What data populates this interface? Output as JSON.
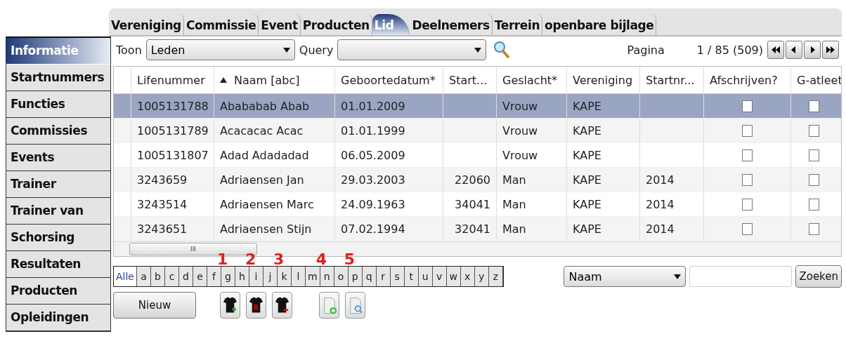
{
  "tabs": [
    {
      "label": "Vereniging",
      "selected": false
    },
    {
      "label": "Commissie",
      "selected": false
    },
    {
      "label": "Event",
      "selected": false
    },
    {
      "label": "Producten",
      "selected": false
    },
    {
      "label": "Lid",
      "selected": true
    },
    {
      "label": "Deelnemers",
      "selected": false
    },
    {
      "label": "Terrein",
      "selected": false
    },
    {
      "label": "openbare bijlage",
      "selected": false
    }
  ],
  "sidebar": {
    "items": [
      {
        "label": "Informatie",
        "selected": true
      },
      {
        "label": "Startnummers",
        "selected": false
      },
      {
        "label": "Functies",
        "selected": false
      },
      {
        "label": "Commissies",
        "selected": false
      },
      {
        "label": "Events",
        "selected": false
      },
      {
        "label": "Trainer",
        "selected": false
      },
      {
        "label": "Trainer van",
        "selected": false
      },
      {
        "label": "Schorsing",
        "selected": false
      },
      {
        "label": "Resultaten",
        "selected": false
      },
      {
        "label": "Producten",
        "selected": false
      },
      {
        "label": "Opleidingen",
        "selected": false
      }
    ]
  },
  "filter": {
    "toon_label": "Toon",
    "toon_value": "Leden",
    "query_label": "Query"
  },
  "pager": {
    "label": "Pagina",
    "position": "1 / 85 (509)"
  },
  "table": {
    "columns": [
      {
        "label": "Lifenummer",
        "sorted": false,
        "kind": "text"
      },
      {
        "label": "Naam [abc]",
        "sorted": true,
        "kind": "text"
      },
      {
        "label": "Geboortedatum*",
        "sorted": false,
        "kind": "text"
      },
      {
        "label": "Start...",
        "sorted": false,
        "kind": "number"
      },
      {
        "label": "Geslacht*",
        "sorted": false,
        "kind": "text"
      },
      {
        "label": "Vereniging",
        "sorted": false,
        "kind": "text"
      },
      {
        "label": "Startnr...",
        "sorted": false,
        "kind": "text"
      },
      {
        "label": "Afschrijven?",
        "sorted": false,
        "kind": "check"
      },
      {
        "label": "G-atleet",
        "sorted": false,
        "kind": "check"
      }
    ],
    "rows": [
      {
        "selected": true,
        "cells": [
          "1005131788",
          "Abababab Abab",
          "01.01.2009",
          "",
          "Vrouw",
          "KAPE",
          "",
          false,
          false
        ]
      },
      {
        "selected": false,
        "cells": [
          "1005131789",
          "Acacacac Acac",
          "01.01.1999",
          "",
          "Vrouw",
          "KAPE",
          "",
          false,
          false
        ]
      },
      {
        "selected": false,
        "cells": [
          "1005131807",
          "Adad Adadadad",
          "06.05.2009",
          "",
          "Vrouw",
          "KAPE",
          "",
          false,
          false
        ]
      },
      {
        "selected": false,
        "cells": [
          "3243659",
          "Adriaensen Jan",
          "29.03.2003",
          "22060",
          "Man",
          "KAPE",
          "2014",
          false,
          false
        ]
      },
      {
        "selected": false,
        "cells": [
          "3243514",
          "Adriaensen Marc",
          "24.09.1963",
          "34041",
          "Man",
          "KAPE",
          "2014",
          false,
          false
        ]
      },
      {
        "selected": false,
        "cells": [
          "3243651",
          "Adriaensen Stijn",
          "07.02.1994",
          "32041",
          "Man",
          "KAPE",
          "2014",
          false,
          false
        ]
      }
    ],
    "scroll_grip": "III"
  },
  "alphabet": [
    {
      "label": "Alle",
      "selected": true
    },
    {
      "label": "a",
      "selected": false
    },
    {
      "label": "b",
      "selected": false
    },
    {
      "label": "c",
      "selected": false
    },
    {
      "label": "d",
      "selected": false
    },
    {
      "label": "e",
      "selected": false
    },
    {
      "label": "f",
      "selected": false
    },
    {
      "label": "g",
      "selected": false,
      "mark": "1"
    },
    {
      "label": "h",
      "selected": false
    },
    {
      "label": "i",
      "selected": false,
      "mark": "2"
    },
    {
      "label": "j",
      "selected": false
    },
    {
      "label": "k",
      "selected": false,
      "mark": "3"
    },
    {
      "label": "l",
      "selected": false
    },
    {
      "label": "m",
      "selected": false
    },
    {
      "label": "n",
      "selected": false,
      "mark": "4"
    },
    {
      "label": "o",
      "selected": false
    },
    {
      "label": "p",
      "selected": false,
      "mark": "5"
    },
    {
      "label": "q",
      "selected": false
    },
    {
      "label": "r",
      "selected": false
    },
    {
      "label": "s",
      "selected": false
    },
    {
      "label": "t",
      "selected": false
    },
    {
      "label": "u",
      "selected": false
    },
    {
      "label": "v",
      "selected": false
    },
    {
      "label": "w",
      "selected": false
    },
    {
      "label": "x",
      "selected": false
    },
    {
      "label": "y",
      "selected": false
    },
    {
      "label": "z",
      "selected": false
    }
  ],
  "search": {
    "field": "Naam",
    "button": "Zoeken"
  },
  "actions": {
    "new_button": "Nieuw",
    "tools": [
      {
        "kind": "shirt-plus"
      },
      {
        "kind": "shirt-r",
        "text": "R"
      },
      {
        "kind": "shirt-minus"
      },
      {
        "kind": "doc-plus"
      },
      {
        "kind": "doc-search"
      }
    ]
  }
}
